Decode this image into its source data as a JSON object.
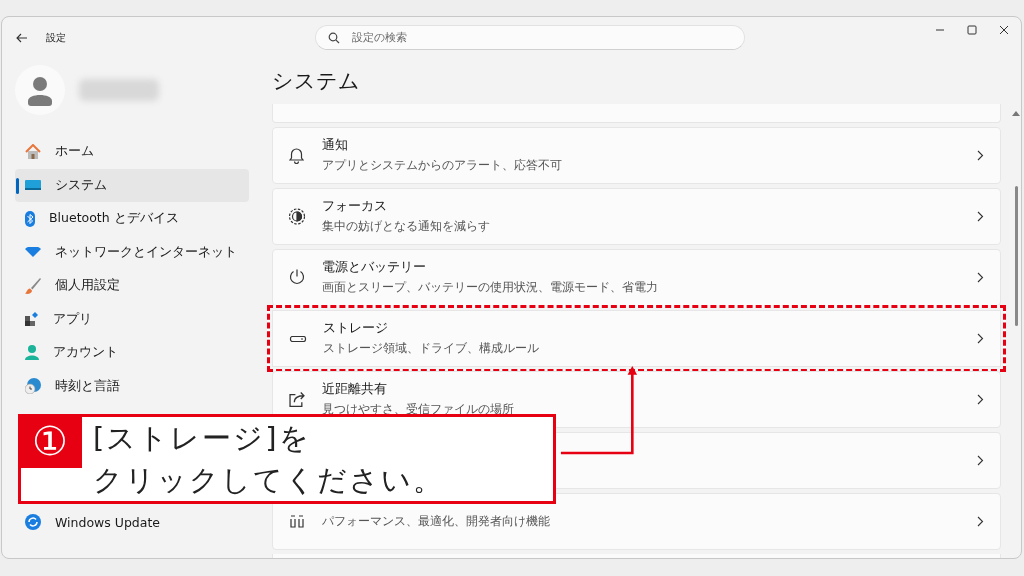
{
  "window": {
    "title": "設定"
  },
  "search": {
    "placeholder": "設定の検索"
  },
  "sidebar": {
    "items": [
      {
        "label": "ホーム",
        "selected": false
      },
      {
        "label": "システム",
        "selected": true
      },
      {
        "label": "Bluetooth とデバイス",
        "selected": false
      },
      {
        "label": "ネットワークとインターネット",
        "selected": false
      },
      {
        "label": "個人用設定",
        "selected": false
      },
      {
        "label": "アプリ",
        "selected": false
      },
      {
        "label": "アカウント",
        "selected": false
      },
      {
        "label": "時刻と言語",
        "selected": false
      },
      {
        "label": "Windows Update",
        "selected": false
      }
    ]
  },
  "page": {
    "heading": "システム",
    "cards": [
      {
        "kind": "partial"
      },
      {
        "kind": "item",
        "title": "通知",
        "subtitle": "アプリとシステムからのアラート、応答不可",
        "highlighted": false
      },
      {
        "kind": "item",
        "title": "フォーカス",
        "subtitle": "集中の妨げとなる通知を減らす",
        "highlighted": false
      },
      {
        "kind": "item",
        "title": "電源とバッテリー",
        "subtitle": "画面とスリープ、バッテリーの使用状況、電源モード、省電力",
        "highlighted": false
      },
      {
        "kind": "item",
        "title": "ストレージ",
        "subtitle": "ストレージ領域、ドライブ、構成ルール",
        "highlighted": true
      },
      {
        "kind": "item",
        "title": "近距離共有",
        "subtitle": "見つけやすさ、受信ファイルの場所",
        "highlighted": false
      },
      {
        "kind": "covered"
      },
      {
        "kind": "item",
        "subtitle": "パフォーマンス、最適化、開発者向け機能",
        "highlighted": false
      },
      {
        "kind": "partial"
      }
    ]
  },
  "callout": {
    "number": "①",
    "lines": [
      "[ストレージ]を",
      "クリックしてください。"
    ]
  }
}
